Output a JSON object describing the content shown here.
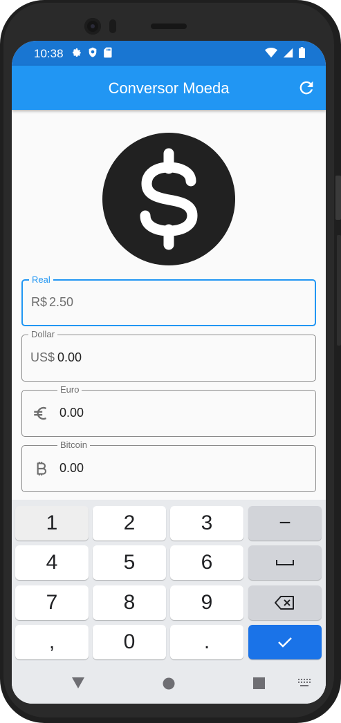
{
  "status": {
    "time": "10:38"
  },
  "appbar": {
    "title": "Conversor Moeda"
  },
  "fields": {
    "real": {
      "label": "Real",
      "prefix": "R$ ",
      "value": "2.50"
    },
    "dollar": {
      "label": "Dollar",
      "prefix": "US$ ",
      "value": "0.00"
    },
    "euro": {
      "label": "Euro",
      "value": "0.00"
    },
    "bitcoin": {
      "label": "Bitcoin",
      "value": "0.00"
    }
  },
  "keyboard": {
    "k1": "1",
    "k2": "2",
    "k3": "3",
    "k4": "4",
    "k5": "5",
    "k6": "6",
    "k7": "7",
    "k8": "8",
    "k9": "9",
    "k0": "0",
    "comma": ",",
    "period": ".",
    "minus": "−"
  },
  "colors": {
    "accent": "#2196f3",
    "status_bar": "#1976d2",
    "done_key": "#1a73e8"
  },
  "icons": [
    "settings-icon",
    "shield-icon",
    "sd-card-icon",
    "wifi-icon",
    "signal-icon",
    "battery-icon",
    "refresh-icon",
    "dollar-logo-icon",
    "euro-icon",
    "bitcoin-icon",
    "space-icon",
    "backspace-icon",
    "check-icon",
    "nav-back-icon",
    "nav-home-icon",
    "nav-recents-icon",
    "keyboard-switch-icon"
  ]
}
